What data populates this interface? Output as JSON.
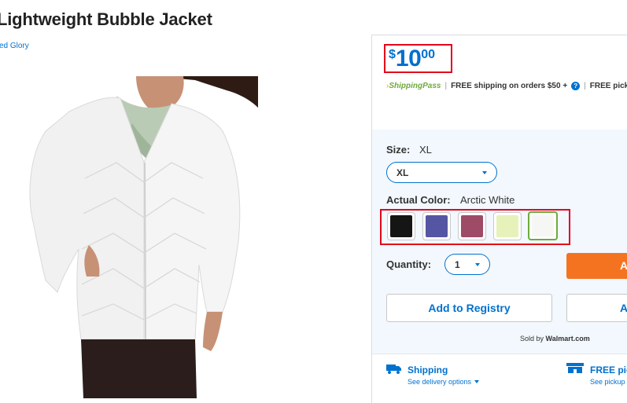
{
  "product": {
    "title": "Lightweight Bubble Jacket",
    "brand": "ed Glory"
  },
  "price": {
    "currency": "$",
    "dollars": "10",
    "cents": "00",
    "color": "#0071ce"
  },
  "shipping_pass": {
    "logo": "ShippingPass",
    "text": "FREE shipping on orders $50 +",
    "pickup": "FREE pickup"
  },
  "size": {
    "label": "Size:",
    "value": "XL",
    "selected": "XL"
  },
  "color": {
    "label": "Actual Color:",
    "value": "Arctic White",
    "swatches": [
      {
        "name": "Black",
        "hex": "#151515"
      },
      {
        "name": "Blue",
        "hex": "#5556a3"
      },
      {
        "name": "Berry",
        "hex": "#9d4b67"
      },
      {
        "name": "Lime",
        "hex": "#e6f2b9"
      },
      {
        "name": "Arctic White",
        "hex": "#f6f6f4",
        "selected": true
      }
    ]
  },
  "quantity": {
    "label": "Quantity:",
    "value": "1"
  },
  "buttons": {
    "add_to_cart": "A",
    "add_to_registry": "Add to Registry",
    "add_to_list": "A"
  },
  "seller": {
    "prefix": "Sold by",
    "name": "Walmart.com"
  },
  "fulfillment": {
    "shipping_title": "Shipping",
    "shipping_sub": "See delivery options",
    "pickup_title": "FREE pic",
    "pickup_sub": "See pickup"
  },
  "accent_colors": {
    "blue": "#0071ce",
    "orange": "#f47321",
    "green": "#6dab3c",
    "highlight": "#e3001b"
  }
}
